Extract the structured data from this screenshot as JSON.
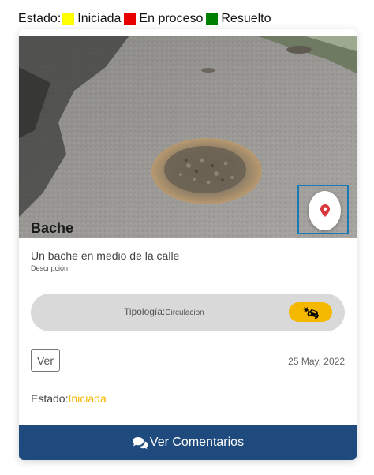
{
  "legend": {
    "prefix": "Estado:",
    "items": [
      {
        "label": "Iniciada",
        "color": "#ffff00"
      },
      {
        "label": "En proceso",
        "color": "#e60000"
      },
      {
        "label": "Resuelto",
        "color": "#008000"
      }
    ]
  },
  "card": {
    "title": "Bache",
    "description": "Un bache en medio de la calle",
    "description_label": "Descripción",
    "tipologia_label": "Tipología:",
    "tipologia_value": "Circulacion",
    "view_button": "Ver",
    "date": "25 May, 2022",
    "status_label": "Estado:",
    "status_value": "Iniciada",
    "comments_button": "Ver Comentarios"
  },
  "colors": {
    "accent_yellow": "#f5b800",
    "footer_blue": "#1f4a7d",
    "map_pin_red": "#d9363e",
    "highlight_frame": "#1a7ab8"
  },
  "icons": {
    "map": "map-pin-icon",
    "tipologia": "car-crash-icon",
    "comments": "comments-icon"
  }
}
